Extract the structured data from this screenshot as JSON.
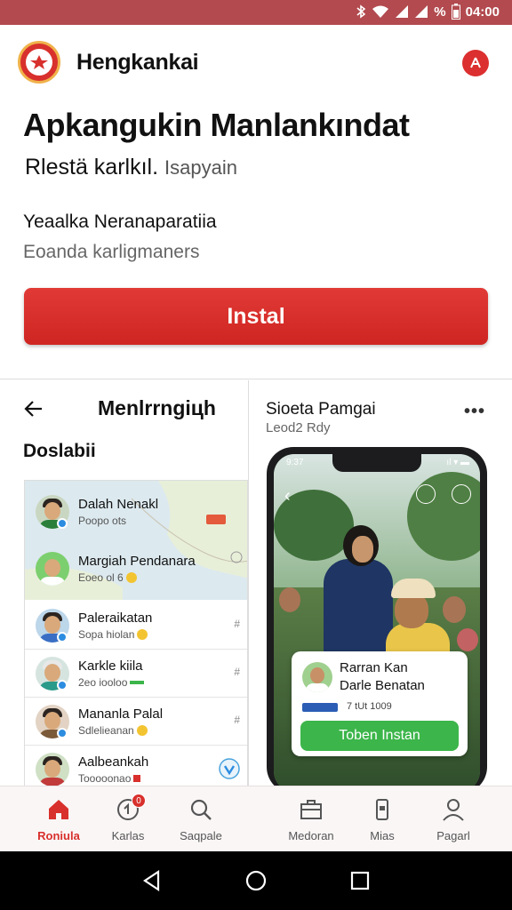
{
  "status_bar": {
    "battery_text": "%",
    "time": "04:00",
    "icons": [
      "bluetooth-icon",
      "wifi-icon",
      "signal-icon",
      "signal-icon",
      "battery-icon"
    ]
  },
  "header": {
    "app_name": "Hengkankai",
    "logo_icon": "emblem-icon",
    "action_icon": "share-icon"
  },
  "listing": {
    "title": "Apkangukin Manlankındat",
    "subtitle_main": "Rlestä karlkıl.",
    "subtitle_secondary": "Isapyain",
    "developer": "Yeaalka Neranaparatiia",
    "developer_sub": "Eoanda karligmaners",
    "install_label": "Instal"
  },
  "left_panel": {
    "title": "Menlrrngiцh",
    "section_label": "Doslabіi",
    "chats": [
      {
        "name": "Dalah Nenakl",
        "sub": "Poopo ots",
        "meta": "",
        "on_map": true,
        "shirt": "#2a7f3a"
      },
      {
        "name": "Margiah Pendanara",
        "sub": "Eoeo ol 6",
        "meta": "",
        "on_map": true,
        "shirt": "#ffffff"
      },
      {
        "name": "Paleraikatan",
        "sub": "Sopa hiolan",
        "meta": "#",
        "on_map": false,
        "shirt": "#3a6ec4"
      },
      {
        "name": "Karkle kiila",
        "sub": "2eo iooloo",
        "meta": "#",
        "on_map": false,
        "shirt": "#2a9a8a"
      },
      {
        "name": "Mananla Palal",
        "sub": "Sdlelieanan",
        "meta": "#",
        "on_map": false,
        "shirt": "#7b5a3a"
      },
      {
        "name": "Aalbeankah",
        "sub": "Tooooonao",
        "meta": "",
        "on_map": false,
        "shirt": "#c23b3b"
      }
    ]
  },
  "right_panel": {
    "title": "Sioeta Pamgai",
    "subtitle": "Leod2 Rdy",
    "more_icon": "more-icon",
    "phone": {
      "time": "9:37",
      "status": "ıl ▾ ▬",
      "card": {
        "name": "Rarran Kan",
        "sub": "Darle Benatan",
        "date": "7 tUt 1009",
        "button": "Toben Instan"
      }
    }
  },
  "bottom_nav": {
    "items": [
      {
        "label": "Roniula",
        "icon": "home-icon",
        "active": true
      },
      {
        "label": "Karlas",
        "icon": "notification-icon",
        "active": false,
        "badge": "0"
      },
      {
        "label": "Saqpale",
        "icon": "search-icon",
        "active": false
      },
      {
        "label": "Medoran",
        "icon": "briefcase-icon",
        "active": false
      },
      {
        "label": "Mias",
        "icon": "device-icon",
        "active": false
      },
      {
        "label": "Pagarl",
        "icon": "profile-icon",
        "active": false
      }
    ]
  },
  "colors": {
    "accent": "#d8302c",
    "status_bar": "#b24a4f",
    "install_button": "#d93230",
    "card_button": "#3cb54a"
  }
}
